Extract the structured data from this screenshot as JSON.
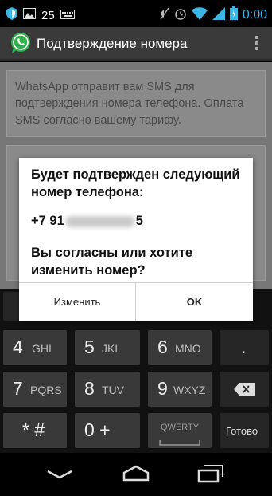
{
  "statusbar": {
    "notification_count": "25",
    "time": "0:00"
  },
  "appbar": {
    "title": "Подтверждение номера"
  },
  "content": {
    "info_text": "WhatsApp отправит вам SMS для подтверждения номера телефона. Оплата SMS согласно вашему тарифу."
  },
  "dialog": {
    "message": "Будет подтвержден следующий номер телефона:",
    "phone_prefix": "+7 91",
    "phone_suffix": "5",
    "question": "Вы согласны или хотите изменить номер?",
    "edit_label": "Изменить",
    "ok_label": "OK"
  },
  "keyboard": {
    "row1": [
      {
        "digit": "4",
        "letters": "GHI"
      },
      {
        "digit": "5",
        "letters": "JKL"
      },
      {
        "digit": "6",
        "letters": "MNO"
      },
      {
        "digit": ".",
        "letters": ""
      }
    ],
    "row2": [
      {
        "digit": "7",
        "letters": "PQRS"
      },
      {
        "digit": "8",
        "letters": "TUV"
      },
      {
        "digit": "9",
        "letters": "WXYZ"
      }
    ],
    "row3": [
      {
        "digit": "* #",
        "letters": ""
      },
      {
        "digit": "0 +",
        "letters": ""
      }
    ],
    "qwerty_label": "QWERTY",
    "done_label": "Готово"
  },
  "icons": {
    "status_left": [
      "shield-icon",
      "image-icon",
      "keyboard-icon"
    ],
    "status_right": [
      "mute-icon",
      "alarm-icon",
      "wifi-icon",
      "signal-icon",
      "battery-icon"
    ],
    "nav": [
      "back-icon",
      "home-icon",
      "recents-icon"
    ]
  },
  "colors": {
    "accent_blue": "#3cb6e6",
    "whatsapp_green": "#2fb24b"
  }
}
